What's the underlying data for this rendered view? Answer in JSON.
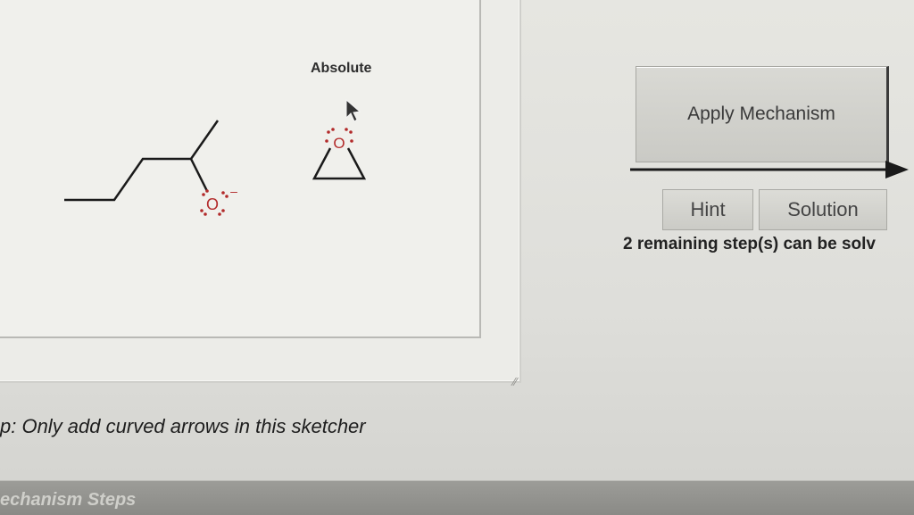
{
  "sketcher": {
    "stereo_label": "Absolute",
    "oxygen_symbol": "O",
    "charge_symbol": "–",
    "resize_handle_glyph": "⁄⁄",
    "colors": {
      "bond": "#1a1a1a",
      "oxygen": "#b22a2a"
    }
  },
  "panel": {
    "apply_label": "Apply Mechanism",
    "hint_label": "Hint",
    "solution_label": "Solution",
    "remaining_text": "2 remaining step(s) can be solv"
  },
  "footer": {
    "tip_text": "p: Only add curved arrows in this sketcher",
    "steps_label": "echanism Steps"
  }
}
